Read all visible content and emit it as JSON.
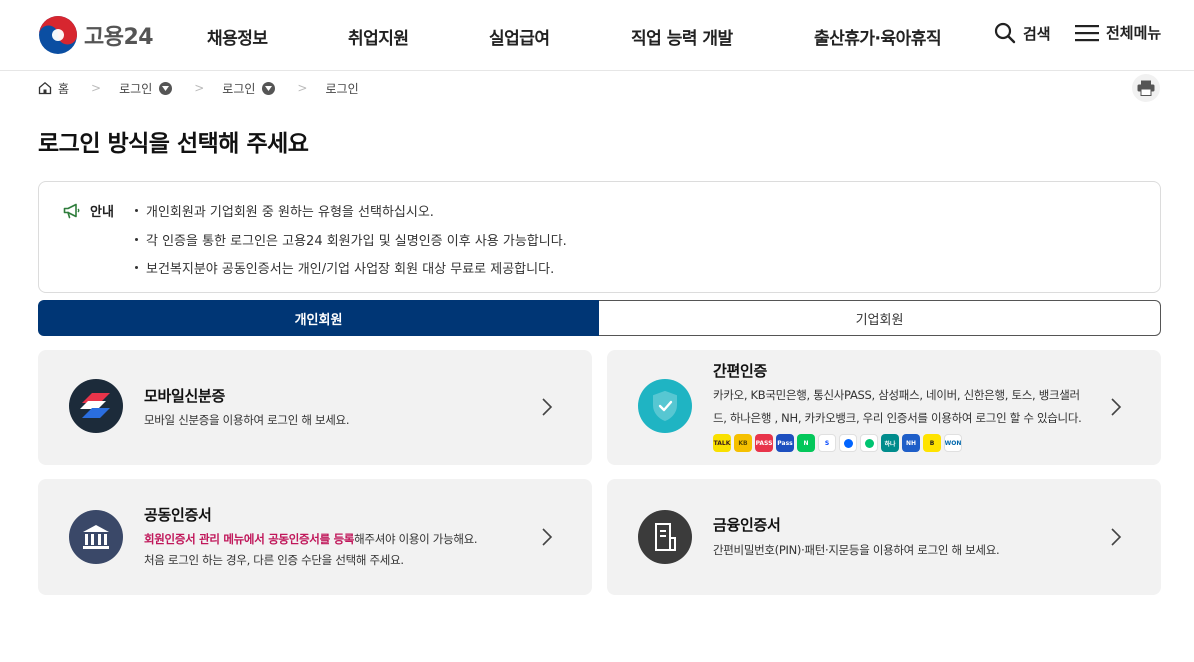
{
  "header": {
    "logo_text": "고용24",
    "nav": [
      "채용정보",
      "취업지원",
      "실업급여",
      "직업 능력 개발",
      "출산휴가·육아휴직"
    ],
    "search_label": "검색",
    "menu_label": "전체메뉴"
  },
  "breadcrumb": {
    "home": "홈",
    "items": [
      "로그인",
      "로그인",
      "로그인"
    ]
  },
  "page_title": "로그인 방식을 선택해 주세요",
  "notice": {
    "label": "안내",
    "lines": [
      "개인회원과 기업회원 중 원하는 유형을 선택하십시오.",
      "각 인증을 통한 로그인은 고용24 회원가입 및 실명인증 이후 사용 가능합니다.",
      "보건복지분야 공동인증서는 개인/기업 사업장 회원 대상 무료로 제공합니다."
    ]
  },
  "tabs": {
    "personal": "개인회원",
    "corporate": "기업회원"
  },
  "cards": {
    "mobile_id": {
      "title": "모바일신분증",
      "desc": "모바일 신분증을 이용하여 로그인 해 보세요."
    },
    "simple_auth": {
      "title": "간편인증",
      "desc1": "카카오, KB국민은행, 통신사PASS, 삼성패스, 네이버, 신한은행, 토스, 뱅크샐러",
      "desc2": "드, 하나은행 , NH, 카카오뱅크, 우리 인증서를 이용하여 로그인 할 수 있습니다.",
      "providers": [
        {
          "name": "kakao-icon",
          "label": "TALK",
          "color": "#f9e000",
          "text": "#3a1d1d"
        },
        {
          "name": "kb-icon",
          "label": "KB",
          "color": "#f5c000",
          "text": "#5b4a00"
        },
        {
          "name": "pass-icon",
          "label": "PASS",
          "color": "#e8344a",
          "text": "#ffffff"
        },
        {
          "name": "samsung-pass-icon",
          "label": "Pass",
          "color": "#1d4fbf",
          "text": "#ffffff"
        },
        {
          "name": "naver-icon",
          "label": "N",
          "color": "#03c75a",
          "text": "#ffffff"
        },
        {
          "name": "shinhan-icon",
          "label": "S",
          "color": "#ffffff",
          "text": "#0046ff"
        },
        {
          "name": "toss-icon",
          "label": "",
          "color": "#ffffff",
          "text": "#0064ff"
        },
        {
          "name": "banksalad-icon",
          "label": "",
          "color": "#ffffff",
          "text": "#00c471"
        },
        {
          "name": "hana-icon",
          "label": "하나",
          "color": "#008c8c",
          "text": "#ffffff"
        },
        {
          "name": "nh-icon",
          "label": "NH",
          "color": "#1e5ec8",
          "text": "#ffffff"
        },
        {
          "name": "kakaobank-icon",
          "label": "B",
          "color": "#ffe300",
          "text": "#1e1e1e"
        },
        {
          "name": "woori-icon",
          "label": "WON",
          "color": "#ffffff",
          "text": "#0067ac"
        }
      ]
    },
    "joint_cert": {
      "title": "공동인증서",
      "desc_em": "회원인증서 관리 메뉴에서 공동인증서를 등록",
      "desc_rest": "해주셔야 이용이 가능해요.",
      "desc2": "처음 로그인 하는 경우, 다른 인증 수단을 선택해 주세요."
    },
    "finance_cert": {
      "title": "금융인증서",
      "desc": "간편비밀번호(PIN)·패턴·지문등을 이용하여 로그인 해 보세요."
    }
  },
  "colors": {
    "primary": "#003675",
    "mobile_icon_bg": "#1c2b3a",
    "simple_icon_bg": "#1fb4c3",
    "joint_icon_bg": "#3a4868",
    "finance_icon_bg": "#3b3b3b",
    "emphasis": "#c0175a"
  }
}
